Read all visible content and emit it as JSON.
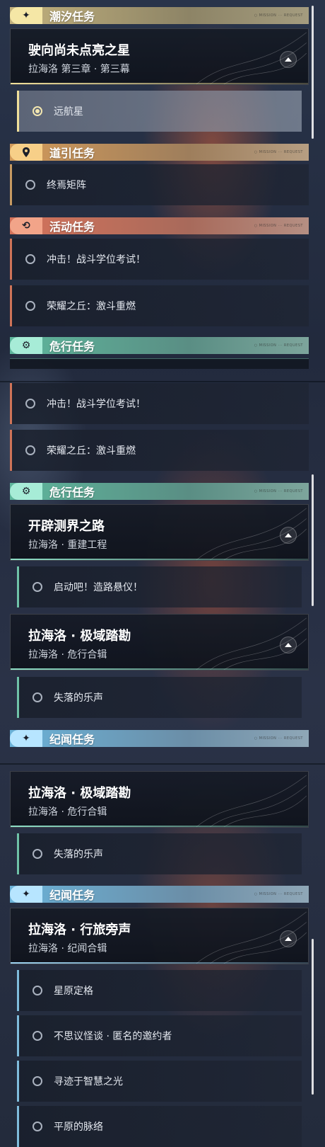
{
  "colors": {
    "tide": "#f5e7a6",
    "guide": "#f7cf88",
    "event": "#f2a489",
    "danger": "#a7ecd7",
    "story": "#b7e5ff"
  },
  "headers": {
    "tide": {
      "label": "潮汐任务",
      "icon": "sparkle-icon"
    },
    "guide": {
      "label": "道引任务",
      "icon": "location-pin-icon"
    },
    "event": {
      "label": "活动任务",
      "icon": "refresh-icon"
    },
    "danger": {
      "label": "危行任务",
      "icon": "gear-eye-icon"
    },
    "story": {
      "label": "纪闻任务",
      "icon": "sparkle-icon"
    }
  },
  "chapters": {
    "star": {
      "title": "驶向尚未点亮之星",
      "subtitle": "拉海洛 第三章 · 第三幕"
    },
    "road": {
      "title": "开辟测界之路",
      "subtitle": "拉海洛 · 重建工程"
    },
    "polar": {
      "title": "拉海洛 · 极域踏勘",
      "subtitle": "拉海洛 · 危行合辑"
    },
    "travel": {
      "title": "拉海洛 · 行旅旁声",
      "subtitle": "拉海洛 · 纪闻合辑"
    }
  },
  "tasks": {
    "voyager": "远航星",
    "matrix": "终焉矩阵",
    "impact": "冲击！战斗学位考试！",
    "glory": "荣耀之丘：激斗重燃",
    "start": "启动吧！造路悬仪！",
    "lost": "失落的乐声",
    "freeze": "星原定格",
    "mystery": "不思议怪谈 · 匿名的邀约者",
    "wisdom": "寻迹于智慧之光",
    "plains": "平原的脉络"
  },
  "tag_text": "○ MISSION ··· REQUEST"
}
